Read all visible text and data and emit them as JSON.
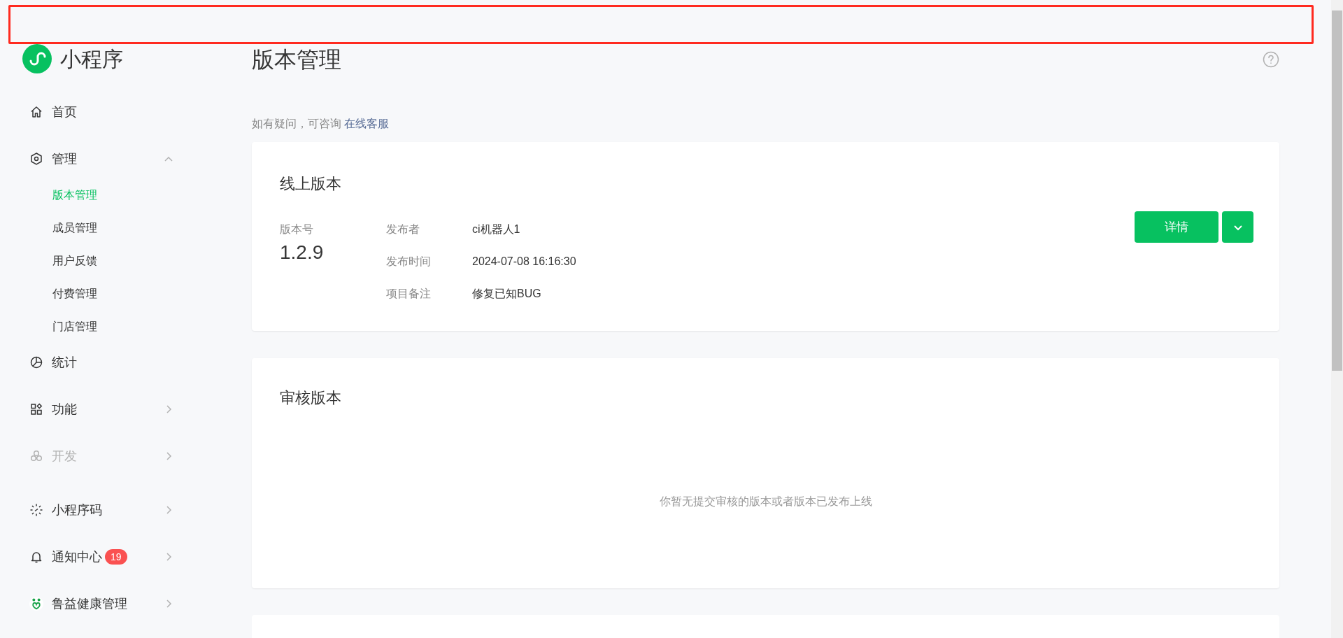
{
  "highlight_frame": {
    "color": "#ff2a1f"
  },
  "sidebar": {
    "logo": {
      "title": "小程序"
    },
    "sections": [
      {
        "items": [
          {
            "kind": "home",
            "label": "首页",
            "disabled": false
          },
          {
            "kind": "manage",
            "label": "管理",
            "disabled": false,
            "expanded": true,
            "children": [
              {
                "label": "版本管理",
                "selected": true
              },
              {
                "label": "成员管理",
                "selected": false
              },
              {
                "label": "用户反馈",
                "selected": false
              },
              {
                "label": "付费管理",
                "selected": false
              },
              {
                "label": "门店管理",
                "selected": false
              }
            ]
          },
          {
            "kind": "stats",
            "label": "统计",
            "disabled": false
          },
          {
            "kind": "features",
            "label": "功能",
            "disabled": false,
            "expanded": false
          },
          {
            "kind": "dev",
            "label": "开发",
            "disabled": true,
            "expanded": false
          }
        ]
      },
      {
        "items": [
          {
            "kind": "qrcode",
            "label": "小程序码",
            "disabled": false,
            "expanded": false
          },
          {
            "kind": "notice",
            "label": "通知中心",
            "disabled": false,
            "expanded": false,
            "badge": "19"
          },
          {
            "kind": "app",
            "label": "鲁益健康管理",
            "disabled": false,
            "expanded": false
          }
        ]
      }
    ]
  },
  "page": {
    "title": "版本管理",
    "hint": "如有疑问，可咨询",
    "hint_link": "在线客服"
  },
  "online_version": {
    "title": "线上版本",
    "version_label": "版本号",
    "version": "1.2.9",
    "details": [
      {
        "label": "发布者",
        "value": "ci机器人1"
      },
      {
        "label": "发布时间",
        "value": "2024-07-08 16:16:30"
      },
      {
        "label": "项目备注",
        "value": "修复已知BUG"
      }
    ],
    "detail_button": "详情"
  },
  "review_version": {
    "title": "审核版本",
    "empty_message": "你暂无提交审核的版本或者版本已发布上线"
  }
}
